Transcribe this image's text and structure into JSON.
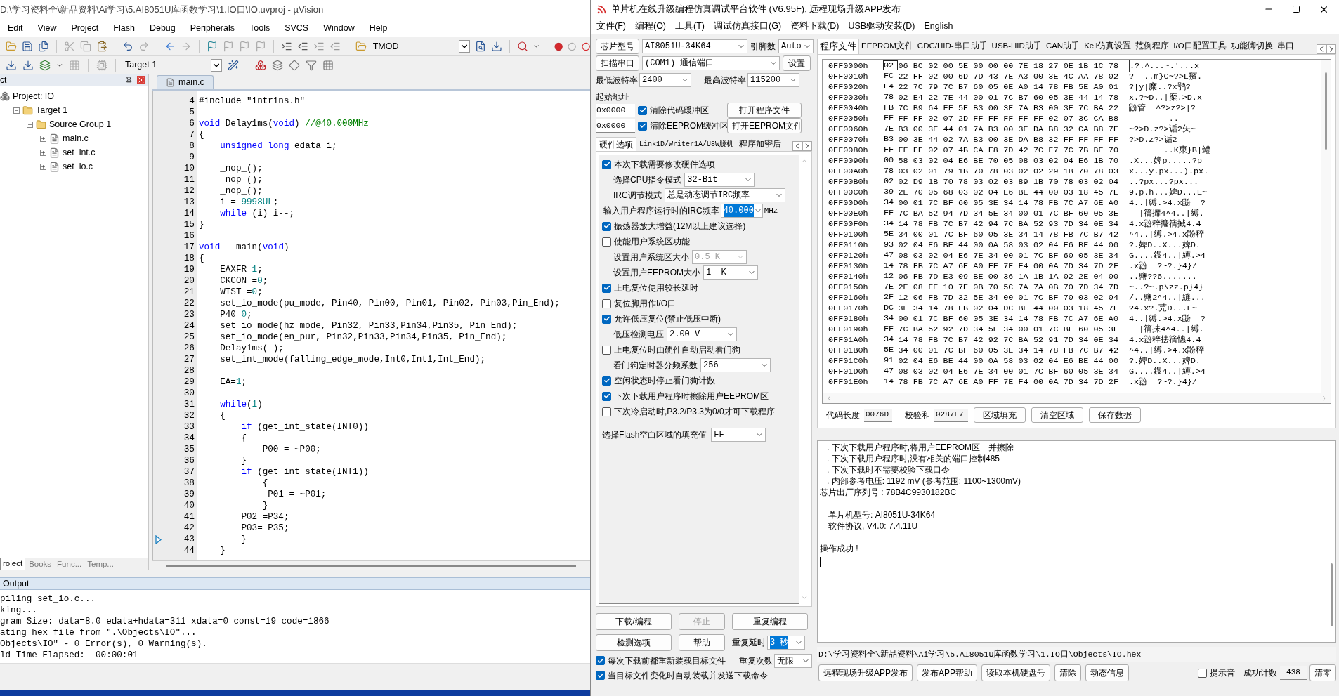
{
  "keil": {
    "title": "D:\\学习资料全\\新品资料\\Ai学习\\5.AI8051U库函数学习\\1.IO口\\IO.uvproj - µVision",
    "menu": [
      "Edit",
      "View",
      "Project",
      "Flash",
      "Debug",
      "Peripherals",
      "Tools",
      "SVCS",
      "Window",
      "Help"
    ],
    "toolbar_field": "TMOD",
    "target_select": "Target 1",
    "project_panel": {
      "title": "ct",
      "tree": [
        {
          "label": "Project: IO",
          "children": [
            {
              "label": "Target 1",
              "expanded": true,
              "children": [
                {
                  "label": "Source Group 1",
                  "expanded": true,
                  "children": [
                    {
                      "label": "main.c",
                      "expanded": false
                    },
                    {
                      "label": "set_int.c",
                      "expanded": false
                    },
                    {
                      "label": "set_io.c",
                      "expanded": false
                    }
                  ]
                }
              ]
            }
          ]
        }
      ],
      "tabs": [
        {
          "label": "roject",
          "selected": true
        },
        {
          "label": "Books",
          "selected": false
        },
        {
          "label": "Func...",
          "selected": false
        },
        {
          "label": "Temp...",
          "selected": false
        }
      ]
    },
    "editor": {
      "tab": "main.c",
      "lines": [
        {
          "no": "4",
          "marked": false,
          "code": [
            {
              "kind": "plain",
              "text": "#include \"intrins.h\""
            }
          ]
        },
        {
          "no": "5",
          "marked": false
        },
        {
          "no": "6",
          "marked": false,
          "code": [
            {
              "kind": "kw",
              "text": "void"
            },
            {
              "kind": "plain",
              "text": " Delay1ms("
            },
            {
              "kind": "kw",
              "text": "void"
            },
            {
              "kind": "plain",
              "text": ") "
            },
            {
              "kind": "cmt",
              "text": "//@40.000MHz"
            }
          ]
        },
        {
          "no": "7",
          "marked": false,
          "code": [
            {
              "kind": "plain",
              "text": "{"
            }
          ]
        },
        {
          "no": "8",
          "marked": false,
          "code": [
            {
              "kind": "kw",
              "text": "    unsigned long"
            },
            {
              "kind": "plain",
              "text": " edata i;"
            }
          ]
        },
        {
          "no": "9",
          "marked": false
        },
        {
          "no": "10",
          "marked": false,
          "code": [
            {
              "kind": "plain",
              "text": "    _nop_();"
            }
          ]
        },
        {
          "no": "11",
          "marked": false,
          "code": [
            {
              "kind": "plain",
              "text": "    _nop_();"
            }
          ]
        },
        {
          "no": "12",
          "marked": false,
          "code": [
            {
              "kind": "plain",
              "text": "    _nop_();"
            }
          ]
        },
        {
          "no": "13",
          "marked": false,
          "code": [
            {
              "kind": "plain",
              "text": "    i = "
            },
            {
              "kind": "num",
              "text": "9998UL"
            },
            {
              "kind": "plain",
              "text": ";"
            }
          ]
        },
        {
          "no": "14",
          "marked": false,
          "code": [
            {
              "kind": "kw",
              "text": "    while"
            },
            {
              "kind": "plain",
              "text": " (i) i--;"
            }
          ]
        },
        {
          "no": "15",
          "marked": false,
          "code": [
            {
              "kind": "plain",
              "text": "}"
            }
          ]
        },
        {
          "no": "16",
          "marked": false
        },
        {
          "no": "17",
          "marked": false,
          "code": [
            {
              "kind": "kw",
              "text": "void"
            },
            {
              "kind": "plain",
              "text": "   main("
            },
            {
              "kind": "kw",
              "text": "void"
            },
            {
              "kind": "plain",
              "text": ")"
            }
          ]
        },
        {
          "no": "18",
          "marked": false,
          "code": [
            {
              "kind": "plain",
              "text": "{"
            }
          ]
        },
        {
          "no": "19",
          "marked": false,
          "code": [
            {
              "kind": "plain",
              "text": "    EAXFR="
            },
            {
              "kind": "num",
              "text": "1"
            },
            {
              "kind": "plain",
              "text": ";"
            }
          ]
        },
        {
          "no": "20",
          "marked": false,
          "code": [
            {
              "kind": "plain",
              "text": "    CKCON ="
            },
            {
              "kind": "num",
              "text": "0"
            },
            {
              "kind": "plain",
              "text": ";"
            }
          ]
        },
        {
          "no": "21",
          "marked": false,
          "code": [
            {
              "kind": "plain",
              "text": "    WTST ="
            },
            {
              "kind": "num",
              "text": "0"
            },
            {
              "kind": "plain",
              "text": ";"
            }
          ]
        },
        {
          "no": "22",
          "marked": false,
          "code": [
            {
              "kind": "plain",
              "text": "    set_io_mode(pu_mode, Pin40, Pin00, Pin01, Pin02, Pin03,Pin_End);"
            }
          ]
        },
        {
          "no": "23",
          "marked": false,
          "code": [
            {
              "kind": "plain",
              "text": "    P40="
            },
            {
              "kind": "num",
              "text": "0"
            },
            {
              "kind": "plain",
              "text": ";"
            }
          ]
        },
        {
          "no": "24",
          "marked": false,
          "code": [
            {
              "kind": "plain",
              "text": "    set_io_mode(hz_mode, Pin32, Pin33,Pin34,Pin35, Pin_End);"
            }
          ]
        },
        {
          "no": "25",
          "marked": false,
          "code": [
            {
              "kind": "plain",
              "text": "    set_io_mode(en_pur, Pin32,Pin33,Pin34,Pin35, Pin_End);"
            }
          ]
        },
        {
          "no": "26",
          "marked": false,
          "code": [
            {
              "kind": "plain",
              "text": "    Delay1ms( );"
            }
          ]
        },
        {
          "no": "27",
          "marked": false,
          "code": [
            {
              "kind": "plain",
              "text": "    set_int_mode(falling_edge_mode,Int0,Int1,Int_End);"
            }
          ]
        },
        {
          "no": "28",
          "marked": false
        },
        {
          "no": "29",
          "marked": false,
          "code": [
            {
              "kind": "plain",
              "text": "    EA="
            },
            {
              "kind": "num",
              "text": "1"
            },
            {
              "kind": "plain",
              "text": ";"
            }
          ]
        },
        {
          "no": "30",
          "marked": false
        },
        {
          "no": "31",
          "marked": false,
          "code": [
            {
              "kind": "kw",
              "text": "    while"
            },
            {
              "kind": "plain",
              "text": "("
            },
            {
              "kind": "num",
              "text": "1"
            },
            {
              "kind": "plain",
              "text": ")"
            }
          ]
        },
        {
          "no": "32",
          "marked": false,
          "code": [
            {
              "kind": "plain",
              "text": "    {"
            }
          ]
        },
        {
          "no": "33",
          "marked": false,
          "code": [
            {
              "kind": "kw",
              "text": "        if"
            },
            {
              "kind": "plain",
              "text": " (get_int_state(INT0))"
            }
          ]
        },
        {
          "no": "34",
          "marked": false,
          "code": [
            {
              "kind": "plain",
              "text": "        {"
            }
          ]
        },
        {
          "no": "35",
          "marked": false,
          "code": [
            {
              "kind": "plain",
              "text": "            P00 = ~P00;"
            }
          ]
        },
        {
          "no": "36",
          "marked": false,
          "code": [
            {
              "kind": "plain",
              "text": "        }"
            }
          ]
        },
        {
          "no": "37",
          "marked": false,
          "code": [
            {
              "kind": "kw",
              "text": "        if"
            },
            {
              "kind": "plain",
              "text": " (get_int_state(INT1))"
            }
          ]
        },
        {
          "no": "38",
          "marked": false,
          "code": [
            {
              "kind": "plain",
              "text": "            {"
            }
          ]
        },
        {
          "no": "39",
          "marked": false,
          "code": [
            {
              "kind": "plain",
              "text": "             P01 = ~P01;"
            }
          ]
        },
        {
          "no": "40",
          "marked": false,
          "code": [
            {
              "kind": "plain",
              "text": "            }"
            }
          ]
        },
        {
          "no": "41",
          "marked": false,
          "code": [
            {
              "kind": "plain",
              "text": "        P02 =P34;"
            }
          ]
        },
        {
          "no": "42",
          "marked": false,
          "code": [
            {
              "kind": "plain",
              "text": "        P03= P35;"
            }
          ]
        },
        {
          "no": "43",
          "marked": true,
          "code": [
            {
              "kind": "plain",
              "text": "        }"
            }
          ]
        },
        {
          "no": "44",
          "marked": false,
          "code": [
            {
              "kind": "plain",
              "text": "    }"
            }
          ]
        }
      ]
    },
    "output": {
      "title": "Output",
      "lines": [
        "piling set_io.c...",
        "king...",
        "gram Size: data=8.0 edata+hdata=311 xdata=0 const=19 code=1866",
        "ating hex file from \".\\Objects\\IO\"...",
        "Objects\\IO\" - 0 Error(s), 0 Warning(s).",
        "ld Time Elapsed:  00:00:01"
      ]
    }
  },
  "isp": {
    "title": "单片机在线升级编程仿真调试平台软件 (V6.95F), 远程现场升级APP发布",
    "menu": [
      "文件(F)",
      "编程(O)",
      "工具(T)",
      "调试仿真接口(G)",
      "资料下载(D)",
      "USB驱动安装(D)",
      "English"
    ],
    "chip": {
      "button": "芯片型号",
      "value": "AI8051U-34K64",
      "pins_label": "引脚数",
      "pins": "Auto"
    },
    "port": {
      "button": "扫描串口",
      "value": "(COM1) 通信端口",
      "settings": "设置"
    },
    "baud": {
      "min_label": "最低波特率",
      "min": "2400",
      "max_label": "最高波特率",
      "max": "115200"
    },
    "start_address": {
      "label": "起始地址",
      "rows": [
        {
          "value": "0x0000",
          "checkbox": "清除代码缓冲区",
          "checked": true,
          "button": "打开程序文件"
        },
        {
          "value": "0x0000",
          "checkbox": "清除EEPROM缓冲区",
          "checked": true,
          "button": "打开EEPROM文件"
        }
      ]
    },
    "left_tabs": [
      {
        "label": "硬件选项",
        "selected": true
      },
      {
        "label": "Link1D/Writer1A/U8W脱机",
        "selected": false
      },
      {
        "label": "程序加密后",
        "selected": false
      }
    ],
    "options": [
      {
        "kind": "checkbox",
        "label": "本次下载需要修改硬件选项",
        "checked": true
      },
      {
        "kind": "select",
        "label": "选择CPU指令模式",
        "value": "32-Bit",
        "disabled": false
      },
      {
        "kind": "select",
        "label": "IRC调节模式",
        "value": "总是动态调节IRC频率",
        "disabled": false
      },
      {
        "kind": "input",
        "label": "输入用户程序运行时的IRC频率",
        "value": "40.000",
        "unit": "MHz"
      },
      {
        "kind": "checkbox",
        "label": "振荡器放大增益(12M以上建议选择)",
        "checked": true
      },
      {
        "kind": "checkbox",
        "label": "使能用户系统区功能",
        "checked": false
      },
      {
        "kind": "select",
        "label": "设置用户系统区大小",
        "value": "0.5 K",
        "disabled": true
      },
      {
        "kind": "select",
        "label": "设置用户EEPROM大小",
        "value": "1  K",
        "disabled": false
      },
      {
        "kind": "checkbox",
        "label": "上电复位使用较长延时",
        "checked": true
      },
      {
        "kind": "checkbox",
        "label": "复位脚用作I/O口",
        "checked": false
      },
      {
        "kind": "checkbox",
        "label": "允许低压复位(禁止低压中断)",
        "checked": true
      },
      {
        "kind": "select",
        "label": "低压检测电压",
        "value": "2.00 V",
        "disabled": false
      },
      {
        "kind": "checkbox",
        "label": "上电复位时由硬件自动启动看门狗",
        "checked": false
      },
      {
        "kind": "select",
        "label": "看门狗定时器分频系数",
        "value": "256",
        "disabled": false
      },
      {
        "kind": "checkbox",
        "label": "空闲状态时停止看门狗计数",
        "checked": true
      },
      {
        "kind": "checkbox",
        "label": "下次下载用户程序时擦除用户EEPROM区",
        "checked": true
      },
      {
        "kind": "checkbox",
        "label": "下次冷启动时,P3.2/P3.3为0/0才可下载程序",
        "checked": false
      }
    ],
    "fill": {
      "label": "选择Flash空白区域的填充值",
      "value": "FF"
    },
    "actions": {
      "download": "下载/编程",
      "stop": "停止",
      "stop_disabled": true,
      "repeat": "重复编程",
      "detect": "检测选项",
      "help": "帮助",
      "delay_label": "重复延时",
      "delay": "3 秒",
      "count_label": "重复次数",
      "count": "无限"
    },
    "auto_options": [
      {
        "label": "每次下载前都重新装载目标文件",
        "checked": true
      },
      {
        "label": "当目标文件变化时自动装载并发送下载命令",
        "checked": true
      }
    ],
    "right_tabs": [
      {
        "label": "程序文件",
        "selected": true
      },
      {
        "label": "EEPROM文件",
        "selected": false
      },
      {
        "label": "CDC/HID-串口助手",
        "selected": false
      },
      {
        "label": "USB-HID助手",
        "selected": false
      },
      {
        "label": "CAN助手",
        "selected": false
      },
      {
        "label": "Keil仿真设置",
        "selected": false
      },
      {
        "label": "范例程序",
        "selected": false
      },
      {
        "label": "I/O口配置工具",
        "selected": false
      },
      {
        "label": "功能脚切换",
        "selected": false
      },
      {
        "label": "串口",
        "selected": false
      }
    ],
    "hex": {
      "rows": [
        {
          "address": "0FF0000h",
          "bytes": "02 06 BC 02 00 5E 00 00 00 7E 18 27 0E 1B 1C 78",
          "ascii": ".?.^...~.'...x",
          "focused": true
        },
        {
          "address": "0FF0010h",
          "bytes": "FC 22 FF 02 00 6D 7D 43 7E A3 00 3E 4C AA 78 02",
          "ascii": "?  ..m}C~?>L獱.",
          "focused": false
        },
        {
          "address": "0FF0020h",
          "bytes": "E4 22 7C 79 7C B7 60 05 0E A0 14 78 FB 5E A0 01",
          "ascii": "?|y|糜..?x鸮?",
          "focused": false
        },
        {
          "address": "0FF0030h",
          "bytes": "78 02 E4 22 7E 44 00 01 7C B7 60 05 3E 44 14 78",
          "ascii": "x.?~D..|糜.>D.x",
          "focused": false
        },
        {
          "address": "0FF0040h",
          "bytes": "FB 7C B9 64 FF 5E B3 00 3E 7A B3 00 3E 7C BA 22",
          "ascii": "鼢管  ^?>z?>|?",
          "focused": false
        },
        {
          "address": "0FF0050h",
          "bytes": "FF FF FF 02 07 2D FF FF FF FF FF 02 07 3C CA B8",
          "ascii": "        ..-",
          "focused": false
        },
        {
          "address": "0FF0060h",
          "bytes": "7E B3 00 3E 44 01 7A B3 00 3E DA B8 32 CA B8 7E",
          "ascii": "~?>D.z?>诟2矢~",
          "focused": false
        },
        {
          "address": "0FF0070h",
          "bytes": "B3 00 3E 44 02 7A B3 00 3E DA B8 32 FF FF FF FF",
          "ascii": "?>D.z?>诟2",
          "focused": false
        },
        {
          "address": "0FF0080h",
          "bytes": "FF FF FF 02 07 4B CA F8 7D 42 7C F7 7C 7B BE 70",
          "ascii": "       ..K柬}B|鳢",
          "focused": false
        },
        {
          "address": "0FF0090h",
          "bytes": "00 58 03 02 04 E6 BE 70 05 08 03 02 04 E6 1B 70",
          "ascii": ".X...婢p.....?p",
          "focused": false
        },
        {
          "address": "0FF00A0h",
          "bytes": "78 03 02 01 79 1B 70 78 03 02 02 29 1B 70 78 03",
          "ascii": "x...y.px...).px.",
          "focused": false
        },
        {
          "address": "0FF00B0h",
          "bytes": "02 02 D9 1B 70 78 03 02 03 89 1B 70 78 03 02 04",
          "ascii": "..?px...?px...",
          "focused": false
        },
        {
          "address": "0FF00C0h",
          "bytes": "39 2E 70 05 68 03 02 04 E6 BE 44 00 03 18 45 7E",
          "ascii": "9.p.h...婢D...E~",
          "focused": false
        },
        {
          "address": "0FF00D0h",
          "bytes": "34 00 01 7C BF 60 05 3E 34 14 78 FB 7C A7 6E A0",
          "ascii": "4..|縛.>4.x鼢  ?",
          "focused": false
        },
        {
          "address": "0FF00E0h",
          "bytes": "FF 7C BA 52 94 7D 34 5E 34 00 01 7C BF 60 05 3E",
          "ascii": "  |篟攠4^4..|縛.",
          "focused": false
        },
        {
          "address": "0FF00F0h",
          "bytes": "34 14 78 FB 7C B7 42 94 7C BA 52 93 7D 34 0E 34",
          "ascii": "4.x鼢稡攟篟搣4.4",
          "focused": false
        },
        {
          "address": "0FF0100h",
          "bytes": "5E 34 00 01 7C BF 60 05 3E 34 14 78 FB 7C B7 42",
          "ascii": "^4..|縛.>4.x鼢稡",
          "focused": false
        },
        {
          "address": "0FF0110h",
          "bytes": "93 02 04 E6 BE 44 00 0A 58 03 02 04 E6 BE 44 00",
          "ascii": "?.婢D..X...婢D.",
          "focused": false
        },
        {
          "address": "0FF0120h",
          "bytes": "47 08 03 02 04 E6 7E 34 00 01 7C BF 60 05 3E 34",
          "ascii": "G....鎪4..|縛.>4",
          "focused": false
        },
        {
          "address": "0FF0130h",
          "bytes": "14 78 FB 7C A7 6E A0 FF 7E F4 00 0A 7D 34 7D 2F",
          "ascii": ".x鼢  ?~?.}4}/",
          "focused": false
        },
        {
          "address": "0FF0140h",
          "bytes": "12 06 FB 7D E3 09 BE 00 36 1A 1B 1A 02 2E 04 00",
          "ascii": "..鹽??6.......",
          "focused": false
        },
        {
          "address": "0FF0150h",
          "bytes": "7E 2E 08 FE 10 7E 0B 70 5C 7A 7A 0B 70 7D 34 7D",
          "ascii": "~..?~.p\\zz.p}4}",
          "focused": false
        },
        {
          "address": "0FF0160h",
          "bytes": "2F 12 06 FB 7D 32 5E 34 00 01 7C BF 70 03 02 04",
          "ascii": "/..鹽2^4..|縫...",
          "focused": false
        },
        {
          "address": "0FF0170h",
          "bytes": "DC 3E 34 14 78 FB 02 04 DC BE 44 00 03 18 45 7E",
          "ascii": "?4.x?.芫D...E~",
          "focused": false
        },
        {
          "address": "0FF0180h",
          "bytes": "34 00 01 7C BF 60 05 3E 34 14 78 FB 7C A7 6E A0",
          "ascii": "4..|縛.>4.x鼢  ?",
          "focused": false
        },
        {
          "address": "0FF0190h",
          "bytes": "FF 7C BA 52 92 7D 34 5E 34 00 01 7C BF 60 05 3E",
          "ascii": "  |篟抺4^4..|縛.",
          "focused": false
        },
        {
          "address": "0FF01A0h",
          "bytes": "34 14 78 FB 7C B7 42 92 7C BA 52 91 7D 34 0E 34",
          "ascii": "4.x鼢稡抾篟憓4.4",
          "focused": false
        },
        {
          "address": "0FF01B0h",
          "bytes": "5E 34 00 01 7C BF 60 05 3E 34 14 78 FB 7C B7 42",
          "ascii": "^4..|縛.>4.x鼢稡",
          "focused": false
        },
        {
          "address": "0FF01C0h",
          "bytes": "91 02 04 E6 BE 44 00 0A 58 03 02 04 E6 BE 44 00",
          "ascii": "?.婢D..X...婢D.",
          "focused": false
        },
        {
          "address": "0FF01D0h",
          "bytes": "47 08 03 02 04 E6 7E 34 00 01 7C BF 60 05 3E 34",
          "ascii": "G....鎪4..|縛.>4",
          "focused": false
        },
        {
          "address": "0FF01E0h",
          "bytes": "14 78 FB 7C A7 6E A0 FF 7E F4 00 0A 7D 34 7D 2F",
          "ascii": ".x鼢  ?~?.}4}/",
          "focused": false
        }
      ]
    },
    "summary": {
      "length_label": "代码长度",
      "length": "0076D",
      "checksum_label": "校验和",
      "checksum": "0287F7",
      "buttons": [
        "区域填充",
        "清空区域",
        "保存数据"
      ]
    },
    "log": {
      "paragraphs": [
        [
          {
            "kind": "bullet",
            "text": ". 下次下载用户程序时,将用户EEPROM区一并擦除"
          },
          {
            "kind": "bullet",
            "text": ". 下次下载用户程序时,没有相关的端口控制485"
          },
          {
            "kind": "bullet",
            "text": ". 下次下载时不需要校验下载口令"
          },
          {
            "kind": "bullet",
            "text": ". 内部参考电压: 1192 mV (参考范围: 1100~1300mV)"
          },
          {
            "kind": "plain",
            "text": "芯片出厂序列号 : 78B4C9930182BC"
          }
        ],
        [
          {
            "kind": "indented",
            "text": "单片机型号: AI8051U-34K64"
          },
          {
            "kind": "indented",
            "text": "软件协议, V4.0: 7.4.11U"
          }
        ],
        [
          {
            "kind": "plain",
            "text": "操作成功 !"
          }
        ]
      ]
    },
    "path": "D:\\学习资料全\\新品资料\\Ai学习\\5.AI8051U库函数学习\\1.IO口\\Objects\\IO.hex",
    "bottom_buttons": [
      "远程现场升级APP发布",
      "发布APP帮助",
      "读取本机硬盘号",
      "清除",
      "动态信息"
    ],
    "sound": {
      "label": "提示音",
      "checked": false
    },
    "success": {
      "label": "成功计数",
      "value": "438",
      "reset": "清零"
    }
  }
}
